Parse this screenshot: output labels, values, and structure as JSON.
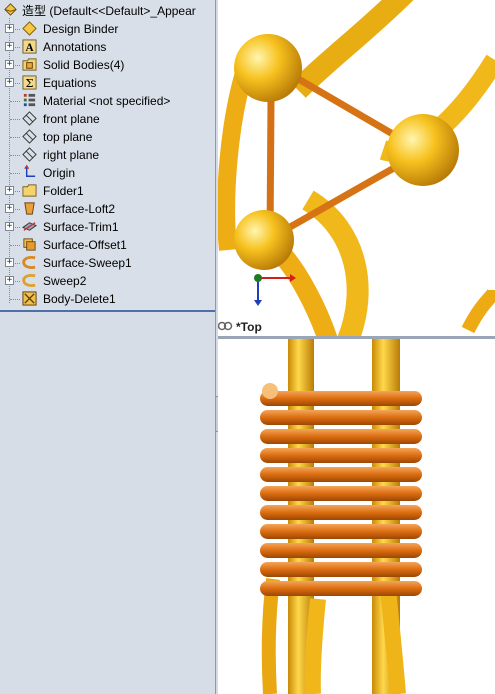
{
  "tree": {
    "root_label": "造型  (Default<<Default>_Appear",
    "items": [
      {
        "label": "Design Binder",
        "icon": "design-binder-icon",
        "expandable": true
      },
      {
        "label": "Annotations",
        "icon": "annotations-icon",
        "expandable": true
      },
      {
        "label": "Solid Bodies(4)",
        "icon": "solid-bodies-folder-icon",
        "expandable": true
      },
      {
        "label": "Equations",
        "icon": "equations-icon",
        "expandable": true
      },
      {
        "label": "Material <not specified>",
        "icon": "material-icon",
        "expandable": false
      },
      {
        "label": "front plane",
        "icon": "plane-icon",
        "expandable": false
      },
      {
        "label": "top plane",
        "icon": "plane-icon",
        "expandable": false
      },
      {
        "label": "right plane",
        "icon": "plane-icon",
        "expandable": false
      },
      {
        "label": "Origin",
        "icon": "origin-icon",
        "expandable": false
      },
      {
        "label": "Folder1",
        "icon": "folder-icon",
        "expandable": true
      },
      {
        "label": "Surface-Loft2",
        "icon": "surface-loft-icon",
        "expandable": true
      },
      {
        "label": "Surface-Trim1",
        "icon": "surface-trim-icon",
        "expandable": true
      },
      {
        "label": "Surface-Offset1",
        "icon": "surface-offset-icon",
        "expandable": false
      },
      {
        "label": "Surface-Sweep1",
        "icon": "surface-sweep-icon",
        "expandable": true
      },
      {
        "label": "Sweep2",
        "icon": "sweep-icon",
        "expandable": true
      },
      {
        "label": "Body-Delete1",
        "icon": "body-delete-icon",
        "expandable": false
      }
    ]
  },
  "viewport": {
    "top_view_label": "*Top",
    "colors": {
      "gold": "#f2b51c",
      "copper": "#e07a1c",
      "background": "#ffffff"
    }
  }
}
